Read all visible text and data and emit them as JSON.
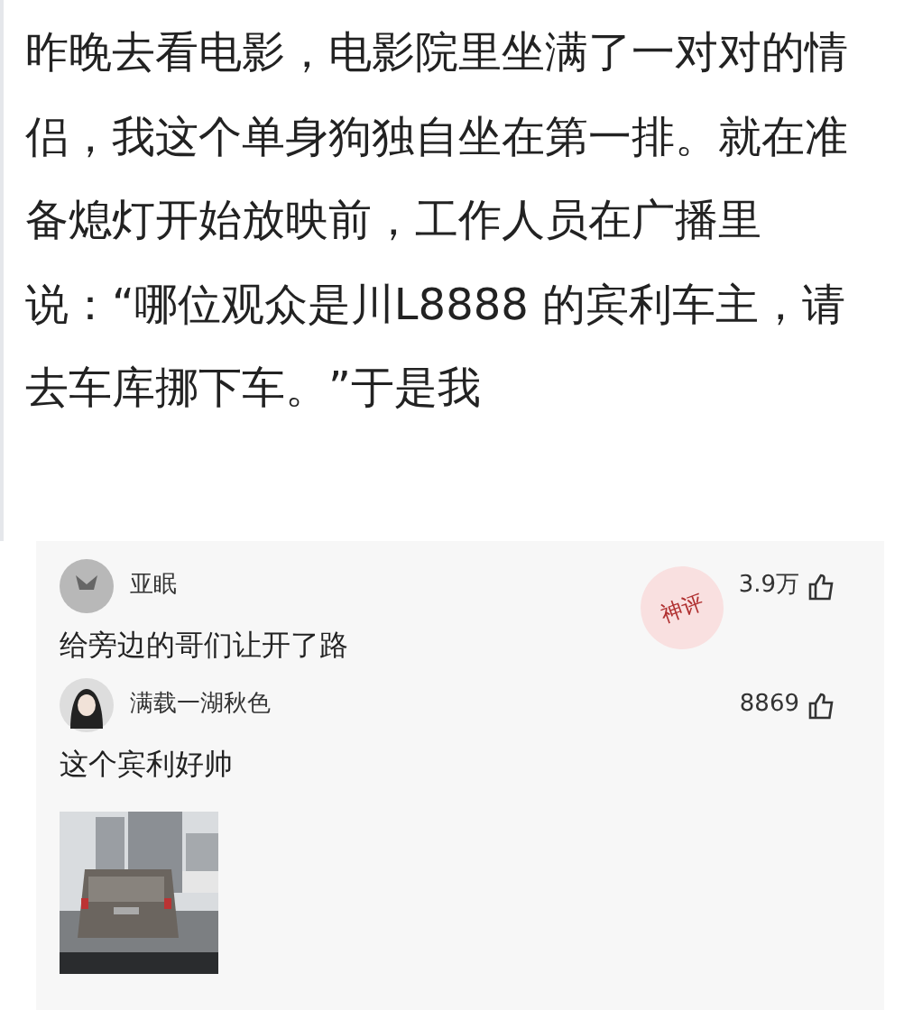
{
  "post": {
    "lines": [
      "昨晚去看电影，电影院里坐满了一对对的情",
      "侣，我这个单身狗独自坐在第一排。就在准",
      "备熄灯开始放映前，工作人员在广播里",
      "说：“哪位观众是川L8888 的宾利车主，请",
      "去车库挪下车。”于是我"
    ]
  },
  "comments": [
    {
      "user": "亚眠",
      "likes": "3.9万",
      "text": "给旁边的哥们让开了路",
      "stamp": "神评"
    },
    {
      "user": "满载一湖秋色",
      "likes": "8869",
      "text": "这个宾利好帅"
    }
  ]
}
